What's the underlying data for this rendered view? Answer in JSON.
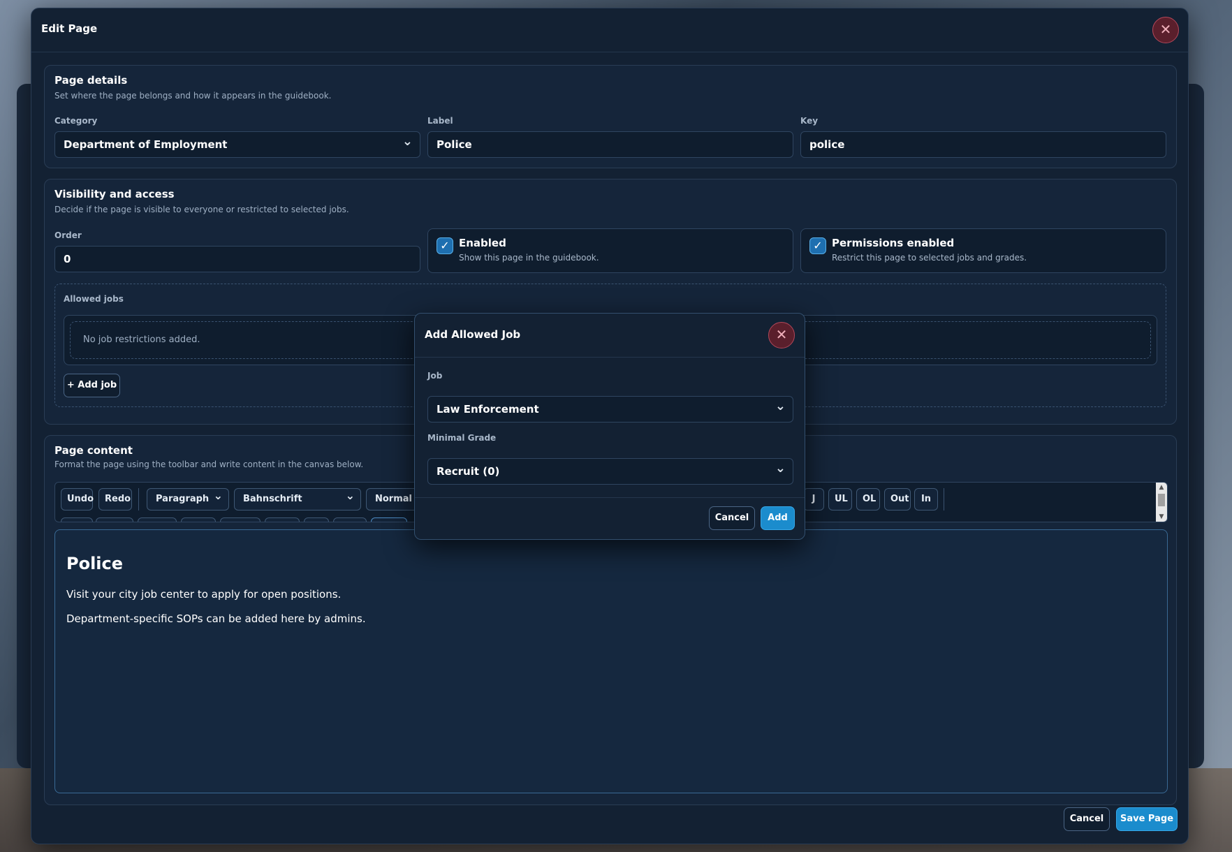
{
  "modal": {
    "title": "Edit Page",
    "page_details": {
      "title": "Page details",
      "subtitle": "Set where the page belongs and how it appears in the guidebook.",
      "category_label": "Category",
      "category_value": "Department of Employment",
      "label_label": "Label",
      "label_value": "Police",
      "key_label": "Key",
      "key_value": "police"
    },
    "visibility": {
      "title": "Visibility and access",
      "subtitle": "Decide if the page is visible to everyone or restricted to selected jobs.",
      "order_label": "Order",
      "order_value": "0",
      "enabled_title": "Enabled",
      "enabled_sub": "Show this page in the guidebook.",
      "enabled_checked": true,
      "permissions_title": "Permissions enabled",
      "permissions_sub": "Restrict this page to selected jobs and grades.",
      "permissions_checked": true,
      "allowed_jobs_label": "Allowed jobs",
      "no_jobs_text": "No job restrictions added.",
      "add_job_label": "+ Add job"
    },
    "content": {
      "title": "Page content",
      "subtitle": "Format the page using the toolbar and write content in the canvas below.",
      "toolbar": {
        "undo": "Undo",
        "redo": "Redo",
        "block": "Paragraph",
        "font": "Bahnschrift",
        "size": "Normal",
        "j": "J",
        "ul": "UL",
        "ol": "OL",
        "out": "Out",
        "in": "In"
      },
      "heading": "Police",
      "paragraph1": "Visit your city job center to apply for open positions.",
      "paragraph2": "Department-specific SOPs can be added here by admins."
    },
    "cancel_label": "Cancel",
    "save_label": "Save Page"
  },
  "dialog": {
    "title": "Add Allowed Job",
    "job_label": "Job",
    "job_value": "Law Enforcement",
    "grade_label": "Minimal Grade",
    "grade_value": "Recruit (0)",
    "cancel_label": "Cancel",
    "add_label": "Add"
  },
  "icons": {
    "close": "close-icon",
    "check": "check-icon",
    "chevron": "chevron-down-icon"
  },
  "colors": {
    "primary": "#1b8ccd",
    "close_bg": "#5a1f2c",
    "panel": "#132133"
  }
}
